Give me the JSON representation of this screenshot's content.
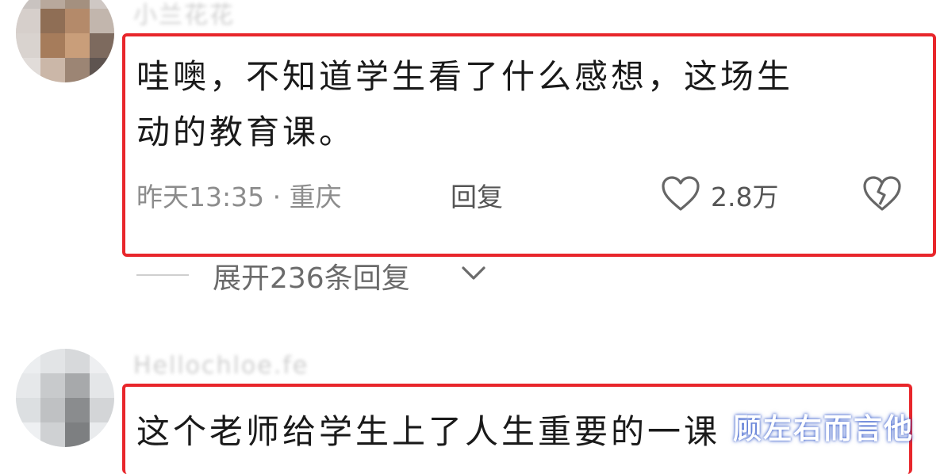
{
  "comments": [
    {
      "username": "小兰花花",
      "text_line1": "哇噢，不知道学生看了什么感想，这场生",
      "text_line2": "动的教育课。",
      "time_location": "昨天13:35 · 重庆",
      "reply_label": "回复",
      "like_count": "2.8万",
      "expand_label": "展开236条回复"
    },
    {
      "username": "Hellochloe.fe",
      "text": "这个老师给学生上了人生重要的一课"
    }
  ],
  "watermark": "顾左右而言他",
  "colors": {
    "highlight_border": "#e8262b",
    "meta_gray": "#8c8c8c"
  },
  "icons": [
    "heart-icon",
    "broken-heart-icon",
    "chevron-down-icon"
  ]
}
